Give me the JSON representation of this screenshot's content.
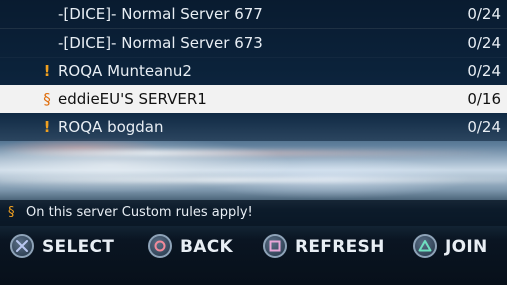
{
  "servers": [
    {
      "icon": "",
      "name": "-[DICE]- Normal Server 677",
      "players": "0/24"
    },
    {
      "icon": "",
      "name": "-[DICE]- Normal Server 673",
      "players": "0/24"
    },
    {
      "icon": "!",
      "name": "ROQA Munteanu2",
      "players": "0/24"
    },
    {
      "icon": "§",
      "name": "eddieEU'S SERVER1",
      "players": "0/16"
    },
    {
      "icon": "!",
      "name": "ROQA bogdan",
      "players": "0/24"
    }
  ],
  "notice": {
    "icon": "§",
    "text": "On this server Custom rules apply!"
  },
  "actions": {
    "select": "SELECT",
    "back": "BACK",
    "refresh": "REFRESH",
    "join": "JOIN"
  },
  "colors": {
    "accent": "#f0a020",
    "selected_row": "#f2f2f2"
  }
}
